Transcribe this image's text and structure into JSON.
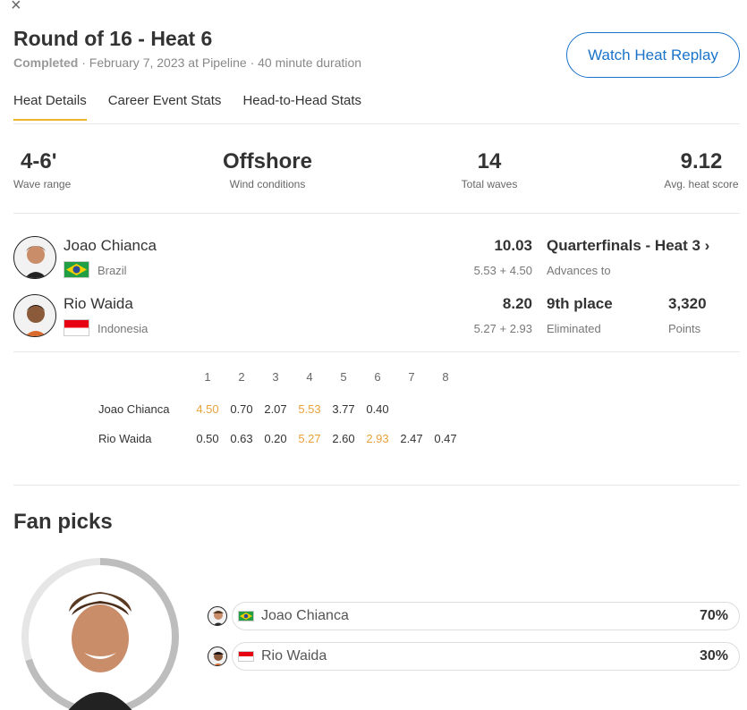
{
  "header": {
    "title": "Round of 16 - Heat 6",
    "status": "Completed",
    "details": " · February 7, 2023 at Pipeline · 40 minute duration",
    "replay_label": "Watch Heat Replay"
  },
  "tabs": [
    {
      "label": "Heat Details",
      "active": true
    },
    {
      "label": "Career Event Stats",
      "active": false
    },
    {
      "label": "Head-to-Head Stats",
      "active": false
    }
  ],
  "stats": [
    {
      "value": "4-6'",
      "label": "Wave range"
    },
    {
      "value": "Offshore",
      "label": "Wind conditions"
    },
    {
      "value": "14",
      "label": "Total waves"
    },
    {
      "value": "9.12",
      "label": "Avg. heat score"
    }
  ],
  "surfers": [
    {
      "name": "Joao Chianca",
      "country": "Brazil",
      "total": "10.03",
      "breakdown": "5.53 + 4.50",
      "result": "Quarterfinals - Heat 3 ›",
      "result_sub": "Advances to"
    },
    {
      "name": "Rio Waida",
      "country": "Indonesia",
      "total": "8.20",
      "breakdown": "5.27 + 2.93",
      "result": "9th place",
      "result_sub": "Eliminated",
      "points": "3,320",
      "points_label": "Points"
    }
  ],
  "wave_scores": {
    "headers": [
      "1",
      "2",
      "3",
      "4",
      "5",
      "6",
      "7",
      "8"
    ],
    "rows": [
      {
        "name": "Joao Chianca",
        "scores": [
          "4.50",
          "0.70",
          "2.07",
          "5.53",
          "3.77",
          "0.40",
          "",
          ""
        ],
        "highlight": [
          0,
          3
        ]
      },
      {
        "name": "Rio Waida",
        "scores": [
          "0.50",
          "0.63",
          "0.20",
          "5.27",
          "2.60",
          "2.93",
          "2.47",
          "0.47"
        ],
        "highlight": [
          3,
          5
        ]
      }
    ]
  },
  "fan_picks": {
    "title": "Fan picks",
    "picks": [
      {
        "name": "Joao Chianca",
        "percent": "70%"
      },
      {
        "name": "Rio Waida",
        "percent": "30%"
      }
    ]
  },
  "colors": {
    "accent": "#1a73c9",
    "highlight": "#e8a33b",
    "tab_underline": "#f0b429"
  }
}
